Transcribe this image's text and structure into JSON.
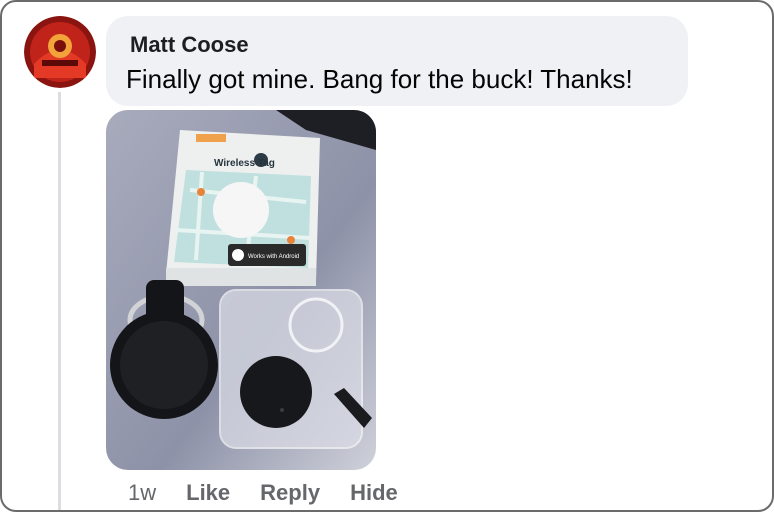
{
  "comment": {
    "author": "Matt Coose",
    "text": "Finally got mine. Bang for the buck! Thanks!",
    "timestamp": "1w"
  },
  "actions": {
    "like": "Like",
    "reply": "Reply",
    "hide": "Hide"
  },
  "photo_text": {
    "box_title": "Wireless Tag",
    "badge": "Works with Android"
  },
  "icons": {
    "avatar": "profile-avatar-icon"
  },
  "colors": {
    "bubble": "#f0f1f4",
    "meta": "#65676b",
    "author": "#1c1e21"
  }
}
